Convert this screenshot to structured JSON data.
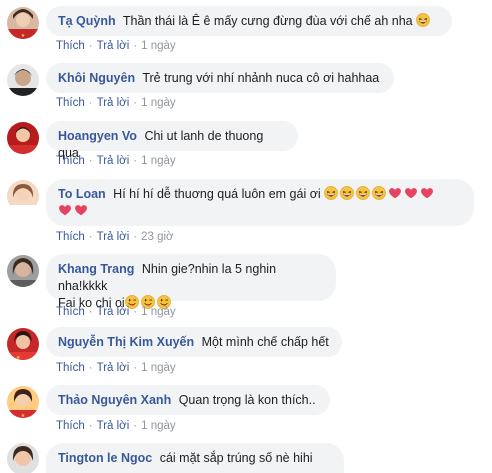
{
  "actions": {
    "like_label": "Thích",
    "reply_label": "Trả lời",
    "separator": "·"
  },
  "colors": {
    "author_link": "#385898",
    "bubble_bg": "#f2f3f5",
    "meta_gray": "#90949c",
    "heart": "#e4445f",
    "emoji_face": "#f7c23f"
  },
  "comments": [
    {
      "author": "Tạ Quỳnh",
      "text": "Thần thái là Ê ê mấy cưng đừng đùa với chế ah nha",
      "emojis": [
        "grin-squint-emoji"
      ],
      "time": "1 ngày"
    },
    {
      "author": "Khôi Nguyên",
      "text": "Trẻ trung với nhí nhảnh nuca cô ơi hahhaa",
      "emojis": [],
      "time": "1 ngày"
    },
    {
      "author": "Hoangyen Vo",
      "text": "Chi ut lanh de thuong qua",
      "emojis": [],
      "time": "1 ngày"
    },
    {
      "author": "To Loan",
      "text": "Hí hí hí dễ thuơng quá luôn em gái ơi",
      "emojis": [
        "grin-squint-emoji",
        "grin-squint-emoji",
        "grin-squint-emoji",
        "grin-squint-emoji",
        "heart-emoji",
        "heart-emoji",
        "heart-emoji",
        "heart-emoji",
        "heart-emoji"
      ],
      "time": "23 giờ"
    },
    {
      "author": "Khang Trang",
      "text": "Nhin gie?nhin la 5 nghin nha!kkkk",
      "text2": "Fai ko chi oi",
      "emojis": [
        "winking-tongue-emoji",
        "winking-tongue-emoji",
        "winking-tongue-emoji"
      ],
      "time": "1 ngày"
    },
    {
      "author": "Nguyễn Thị Kim Xuyến",
      "text": "Một mình chế chấp hết",
      "emojis": [],
      "time": "1 ngày"
    },
    {
      "author": "Thảo Nguyên Xanh",
      "text": "Quan trọng là kon thích..",
      "emojis": [],
      "time": "1 ngày"
    },
    {
      "author": "Tington le Ngoc",
      "text": "cái mặt sắp trúng số nè hihi",
      "emojis": [],
      "time": ""
    }
  ]
}
